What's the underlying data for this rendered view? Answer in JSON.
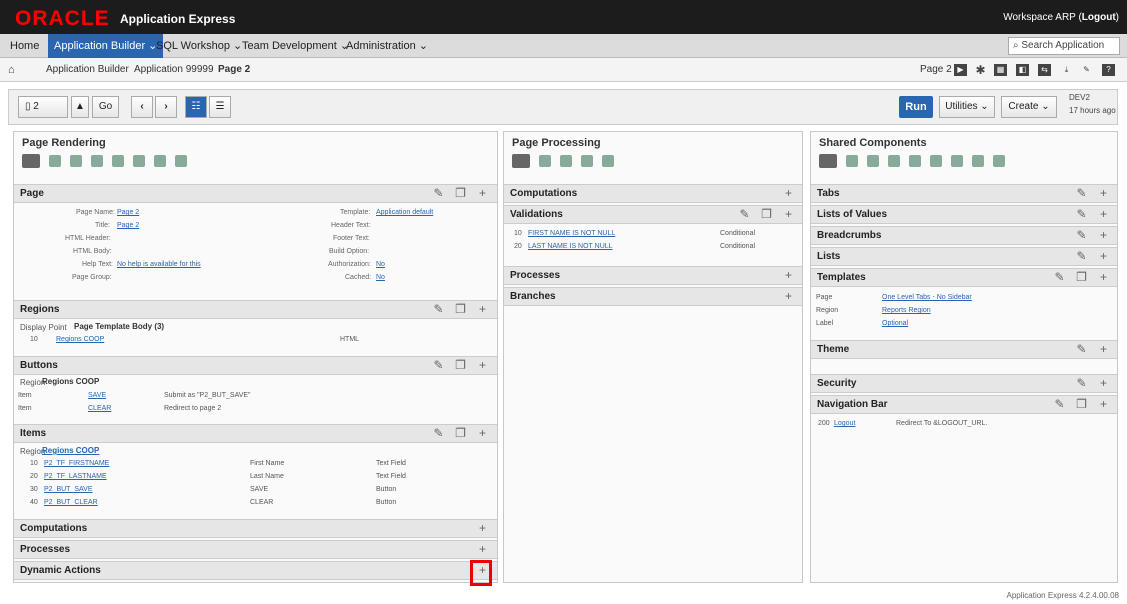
{
  "header": {
    "logo": "ORACLE",
    "app": "Application Express",
    "workspace": "Workspace ARP (",
    "logout": "Logout",
    ")": ")"
  },
  "nav": {
    "home": "Home",
    "builder": "Application Builder ⌄",
    "sql": "SQL Workshop ⌄",
    "team": "Team Development ⌄",
    "admin": "Administration ⌄",
    "search": "Search Application"
  },
  "breadcrumb": {
    "b1": "Application Builder",
    "b2": "Application 99999",
    "b3": "Page 2",
    "page": "Page 2"
  },
  "toolbar": {
    "page_value": "2",
    "go": "Go",
    "run": "Run",
    "utilities": "Utilities ⌄",
    "create": "Create ⌄",
    "dev": "DEV2",
    "ago": "17 hours ago"
  },
  "rendering": {
    "title": "Page Rendering",
    "page": "Page",
    "page_name_l": "Page Name:",
    "page_name": "Page 2",
    "title_l": "Title:",
    "title_v": "Page 2",
    "html_header": "HTML Header:",
    "html_body": "HTML Body:",
    "help_l": "Help Text:",
    "help": "No help is available for this",
    "page_group": "Page Group:",
    "template_l": "Template:",
    "template": "Application default",
    "header_text": "Header Text:",
    "footer_text": "Footer Text:",
    "build_option": "Build Option:",
    "auth_l": "Authorization:",
    "auth": "No",
    "cached_l": "Cached:",
    "cached": "No",
    "regions": "Regions",
    "display_point": "Display Point",
    "ptb": "Page Template Body (3)",
    "r10": "10",
    "regcoop": "Regions COOP",
    "html": "HTML",
    "buttons": "Buttons",
    "region_l": "Region",
    "regions_coop": "Regions COOP",
    "item1": "Item",
    "save": "SAVE",
    "submit": "Submit as \"P2_BUT_SAVE\"",
    "item2": "Item",
    "clear": "CLEAR",
    "redirect": "Redirect to page 2",
    "items": "Items",
    "items_region": "Regions COOP",
    "it": [
      {
        "n": "10",
        "name": "P2_TF_FIRSTNAME",
        "lab": "First Name",
        "type": "Text Field"
      },
      {
        "n": "20",
        "name": "P2_TF_LASTNAME",
        "lab": "Last Name",
        "type": "Text Field"
      },
      {
        "n": "30",
        "name": "P2_BUT_SAVE",
        "lab": "SAVE",
        "type": "Button"
      },
      {
        "n": "40",
        "name": "P2_BUT_CLEAR",
        "lab": "CLEAR",
        "type": "Button"
      }
    ],
    "computations": "Computations",
    "processes": "Processes",
    "dynamic": "Dynamic Actions"
  },
  "processing": {
    "title": "Page Processing",
    "computations": "Computations",
    "validations": "Validations",
    "v1": "10",
    "v1n": "FIRST NAME IS NOT NULL",
    "v1c": "Conditional",
    "v2": "20",
    "v2n": "LAST NAME IS NOT NULL",
    "v2c": "Conditional",
    "processes": "Processes",
    "branches": "Branches"
  },
  "shared": {
    "title": "Shared Components",
    "tabs": "Tabs",
    "lov": "Lists of Values",
    "breadcrumbs": "Breadcrumbs",
    "lists": "Lists",
    "templates": "Templates",
    "page_l": "Page",
    "page_v": "One Level Tabs - No Sidebar",
    "region_l": "Region",
    "region_v": "Reports Region",
    "label_l": "Label",
    "label_v": "Optional",
    "theme": "Theme",
    "security": "Security",
    "navbar": "Navigation Bar",
    "nb_n": "200",
    "nb_link": "Logout",
    "nb_text": "Redirect To &LOGOUT_URL."
  },
  "footer": {
    "version": "Application Express 4.2.4.00.08"
  }
}
